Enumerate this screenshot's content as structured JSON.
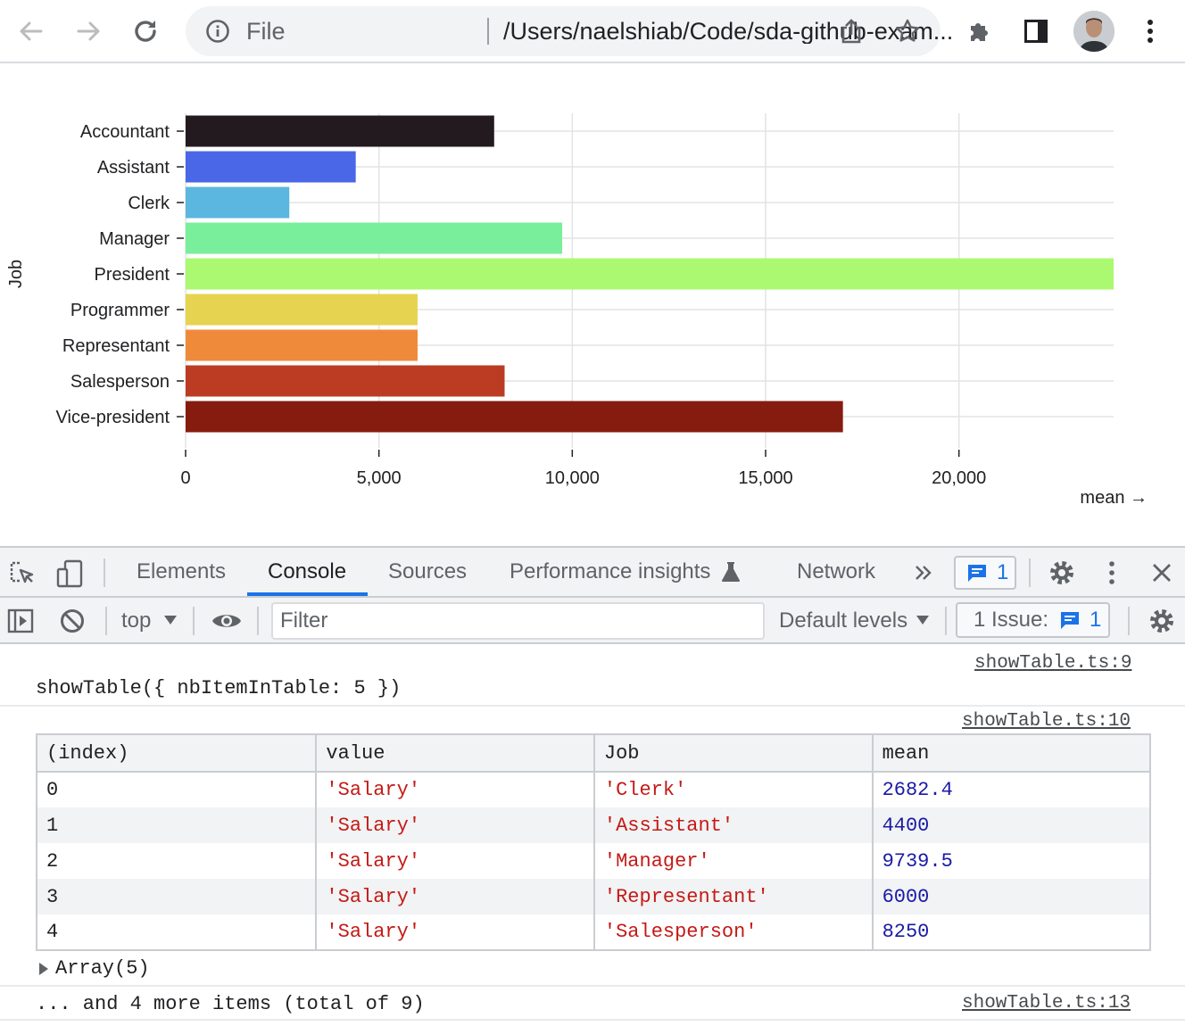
{
  "browser": {
    "scheme": "File",
    "url": "/Users/naelshiab/Code/sda-github-exam..."
  },
  "chart_data": {
    "type": "bar",
    "orientation": "horizontal",
    "ylabel": "Job",
    "xlabel": "mean →",
    "xlim": [
      0,
      24000
    ],
    "xticks": [
      0,
      5000,
      10000,
      15000,
      20000
    ],
    "xtick_labels": [
      "0",
      "5,000",
      "10,000",
      "15,000",
      "20,000"
    ],
    "grid": true,
    "categories": [
      "Accountant",
      "Assistant",
      "Clerk",
      "Manager",
      "President",
      "Programmer",
      "Representant",
      "Salesperson",
      "Vice-president"
    ],
    "values": [
      7980,
      4400,
      2682.4,
      9739.5,
      24000,
      6000,
      6000,
      8250,
      17000
    ],
    "colors": [
      "#231a1f",
      "#4a67e7",
      "#5bb7df",
      "#7aef9b",
      "#abf970",
      "#e6d450",
      "#f08a3b",
      "#bb3c22",
      "#861c10"
    ]
  },
  "devtools": {
    "tabs": [
      "Elements",
      "Console",
      "Sources",
      "Performance insights",
      "Network"
    ],
    "active_tab": "Console",
    "messages_badge": "1",
    "context": "top",
    "filter_placeholder": "Filter",
    "levels": "Default levels",
    "issues_label": "1 Issue:",
    "issues_count": "1"
  },
  "console": {
    "log1": {
      "source": "showTable.ts:9",
      "text": "showTable({ nbItemInTable: 5 })"
    },
    "log2": {
      "source": "showTable.ts:10"
    },
    "table": {
      "headers": [
        "(index)",
        "value",
        "Job",
        "mean"
      ],
      "rows": [
        [
          "0",
          "'Salary'",
          "'Clerk'",
          "2682.4"
        ],
        [
          "1",
          "'Salary'",
          "'Assistant'",
          "4400"
        ],
        [
          "2",
          "'Salary'",
          "'Manager'",
          "9739.5"
        ],
        [
          "3",
          "'Salary'",
          "'Representant'",
          "6000"
        ],
        [
          "4",
          "'Salary'",
          "'Salesperson'",
          "8250"
        ]
      ]
    },
    "array_label": "Array(5)",
    "log3": {
      "source": "showTable.ts:13",
      "text": "... and 4 more items (total of 9)"
    }
  }
}
